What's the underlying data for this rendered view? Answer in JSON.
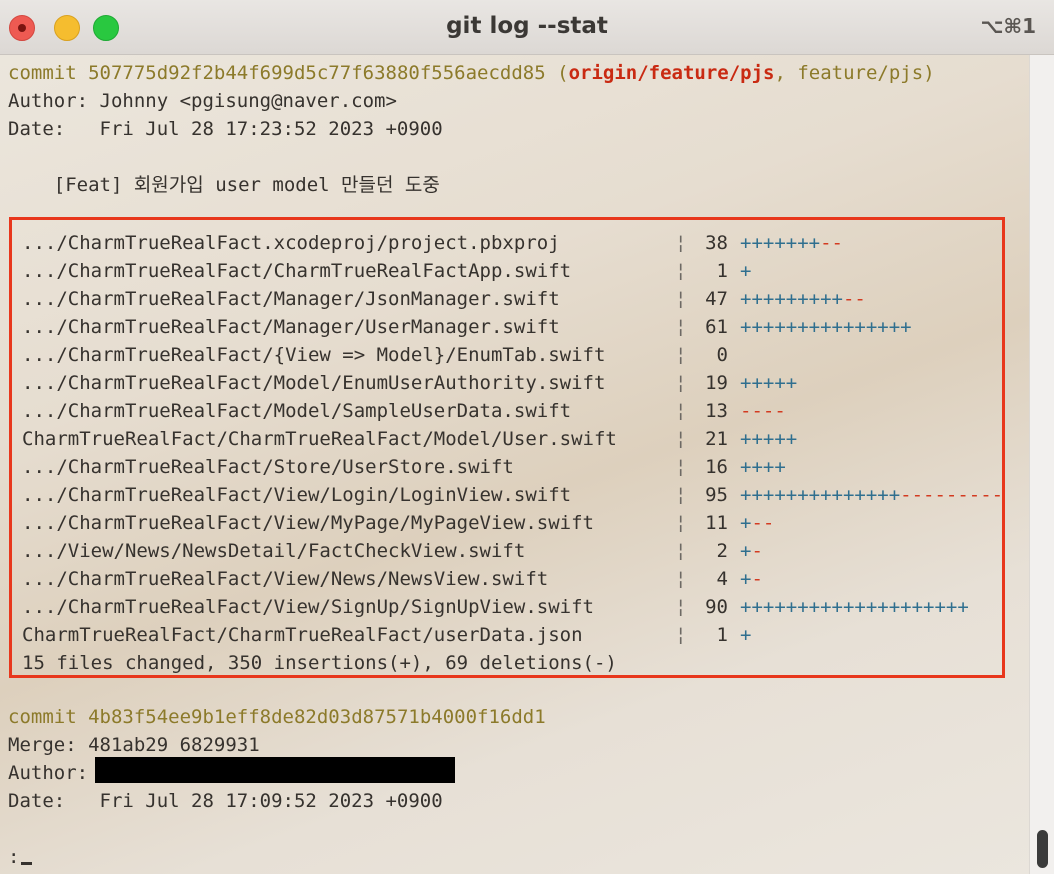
{
  "window": {
    "title": "git log --stat",
    "shortcut": "⌥⌘1"
  },
  "colors": {
    "commit": "#8c7a2a",
    "remote_ref": "#c92a12",
    "plus": "#2f6f8f",
    "minus": "#d33a20",
    "highlight_border": "#e8371c"
  },
  "commit1": {
    "label": "commit",
    "hash": "507775d92f2b44f699d5c77f63880f556aecdd85",
    "open_paren": "(",
    "remote_ref": "origin/feature/pjs",
    "separator": ", ",
    "local_ref": "feature/pjs",
    "close_paren": ")",
    "author_line": "Author: Johnny <pgisung@naver.com>",
    "date_line": "Date:   Fri Jul 28 17:23:52 2023 +0900",
    "message": "    [Feat] 회원가입 user model 만들던 도중"
  },
  "stats": [
    {
      "file": ".../CharmTrueRealFact.xcodeproj/project.pbxproj",
      "count": "38",
      "plus": "+++++++",
      "minus": "--"
    },
    {
      "file": ".../CharmTrueRealFact/CharmTrueRealFactApp.swift",
      "count": "1",
      "plus": "+",
      "minus": ""
    },
    {
      "file": ".../CharmTrueRealFact/Manager/JsonManager.swift",
      "count": "47",
      "plus": "+++++++++",
      "minus": "--"
    },
    {
      "file": ".../CharmTrueRealFact/Manager/UserManager.swift",
      "count": "61",
      "plus": "+++++++++++++++",
      "minus": ""
    },
    {
      "file": ".../CharmTrueRealFact/{View => Model}/EnumTab.swift",
      "count": "0",
      "plus": "",
      "minus": ""
    },
    {
      "file": ".../CharmTrueRealFact/Model/EnumUserAuthority.swift",
      "count": "19",
      "plus": "+++++",
      "minus": ""
    },
    {
      "file": ".../CharmTrueRealFact/Model/SampleUserData.swift",
      "count": "13",
      "plus": "",
      "minus": "----"
    },
    {
      "file": "CharmTrueRealFact/CharmTrueRealFact/Model/User.swift",
      "count": "21",
      "plus": "+++++",
      "minus": ""
    },
    {
      "file": ".../CharmTrueRealFact/Store/UserStore.swift",
      "count": "16",
      "plus": "++++",
      "minus": ""
    },
    {
      "file": ".../CharmTrueRealFact/View/Login/LoginView.swift",
      "count": "95",
      "plus": "++++++++++++++",
      "minus": "---------"
    },
    {
      "file": ".../CharmTrueRealFact/View/MyPage/MyPageView.swift",
      "count": "11",
      "plus": "+",
      "minus": "--"
    },
    {
      "file": ".../View/News/NewsDetail/FactCheckView.swift",
      "count": "2",
      "plus": "+",
      "minus": "-"
    },
    {
      "file": ".../CharmTrueRealFact/View/News/NewsView.swift",
      "count": "4",
      "plus": "+",
      "minus": "-"
    },
    {
      "file": ".../CharmTrueRealFact/View/SignUp/SignUpView.swift",
      "count": "90",
      "plus": "++++++++++++++++++++",
      "minus": ""
    },
    {
      "file": "CharmTrueRealFact/CharmTrueRealFact/userData.json",
      "count": "1",
      "plus": "+",
      "minus": ""
    }
  ],
  "stat_pipe": "¦",
  "summary": "15 files changed, 350 insertions(+), 69 deletions(-)",
  "commit2": {
    "label": "commit",
    "hash": "4b83f54ee9b1eff8de82d03d87571b4000f16dd1",
    "merge_line": "Merge: 481ab29 6829931",
    "author_label": "Author:",
    "date_line": "Date:   Fri Jul 28 17:09:52 2023 +0900"
  },
  "prompt": ":"
}
